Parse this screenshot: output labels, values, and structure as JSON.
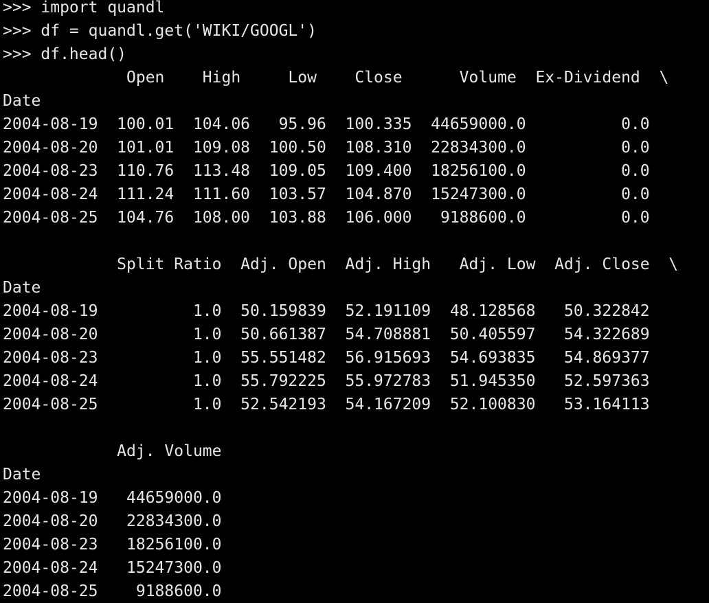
{
  "terminal": {
    "lines": [
      ">>> import quandl",
      ">>> df = quandl.get('WIKI/GOOGL')",
      ">>> df.head()",
      "             Open    High     Low    Close      Volume  Ex-Dividend  \\",
      "Date",
      "2004-08-19  100.01  104.06   95.96  100.335  44659000.0          0.0",
      "2004-08-20  101.01  109.08  100.50  108.310  22834300.0          0.0",
      "2004-08-23  110.76  113.48  109.05  109.400  18256100.0          0.0",
      "2004-08-24  111.24  111.60  103.57  104.870  15247300.0          0.0",
      "2004-08-25  104.76  108.00  103.88  106.000   9188600.0          0.0",
      "",
      "            Split Ratio  Adj. Open  Adj. High   Adj. Low  Adj. Close  \\",
      "Date",
      "2004-08-19          1.0  50.159839  52.191109  48.128568   50.322842",
      "2004-08-20          1.0  50.661387  54.708881  50.405597   54.322689",
      "2004-08-23          1.0  55.551482  56.915693  54.693835   54.869377",
      "2004-08-24          1.0  55.792225  55.972783  51.945350   52.597363",
      "2004-08-25          1.0  52.542193  54.167209  52.100830   53.164113",
      "",
      "            Adj. Volume",
      "Date",
      "2004-08-19   44659000.0",
      "2004-08-20   22834300.0",
      "2004-08-23   18256100.0",
      "2004-08-24   15247300.0",
      "2004-08-25    9188600.0"
    ]
  }
}
